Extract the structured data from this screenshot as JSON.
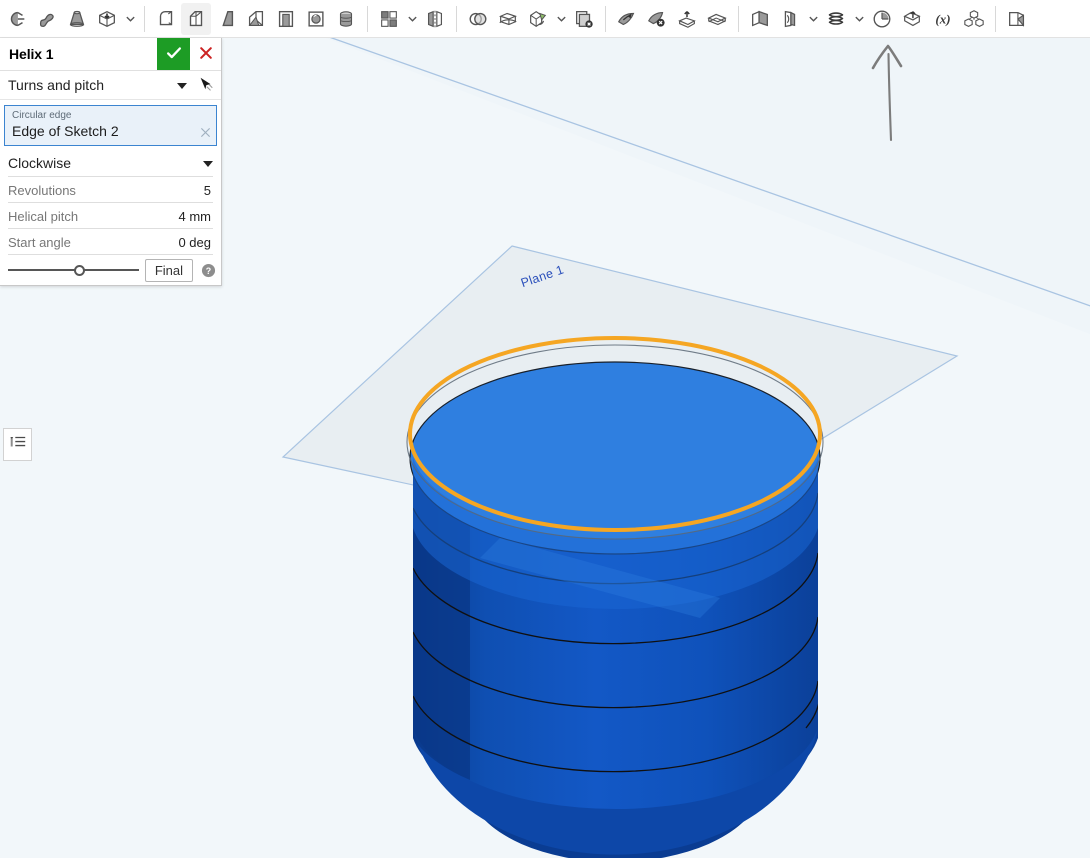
{
  "app": {
    "name": "Onshape Part Studio",
    "background_color": "#f2f7fa",
    "accent_color": "#3b84d0",
    "confirm_color": "#1d9c25",
    "cancel_color": "#cc2222",
    "selection_color": "#f5a623"
  },
  "toolbar": {
    "groups": [
      {
        "name": "sweep-loft-group",
        "items": [
          {
            "icon": "sweep-icon",
            "label": "Sweep"
          },
          {
            "icon": "loft-icon",
            "label": "Loft"
          },
          {
            "icon": "revolve-taper-icon",
            "label": "Revolve"
          },
          {
            "icon": "thicken-icon",
            "label": "Thicken"
          }
        ],
        "has_caret": true
      },
      {
        "name": "modify-group",
        "items": [
          {
            "icon": "fillet-icon",
            "label": "Fillet"
          },
          {
            "icon": "chamfer-icon",
            "label": "Chamfer",
            "active": true
          },
          {
            "icon": "draft-icon",
            "label": "Draft"
          },
          {
            "icon": "rib-icon",
            "label": "Rib"
          },
          {
            "icon": "shell-icon",
            "label": "Shell"
          },
          {
            "icon": "hole-icon",
            "label": "Hole"
          },
          {
            "icon": "thread-icon",
            "label": "Thread"
          }
        ],
        "has_caret": false
      },
      {
        "name": "pattern-group",
        "items": [
          {
            "icon": "linear-pattern-icon",
            "label": "Pattern"
          }
        ],
        "has_caret": true
      },
      {
        "name": "mirror-group",
        "items": [
          {
            "icon": "mirror-icon",
            "label": "Mirror"
          }
        ],
        "has_caret": false
      },
      {
        "name": "boolean-group",
        "items": [
          {
            "icon": "boolean-icon",
            "label": "Boolean"
          },
          {
            "icon": "split-icon",
            "label": "Split"
          },
          {
            "icon": "transform-icon",
            "label": "Transform"
          }
        ],
        "has_caret": true
      },
      {
        "name": "delete-part-group",
        "items": [
          {
            "icon": "delete-part-icon",
            "label": "Delete part"
          }
        ],
        "has_caret": false
      },
      {
        "name": "surface-group",
        "items": [
          {
            "icon": "move-face-icon",
            "label": "Move face"
          },
          {
            "icon": "delete-face-icon",
            "label": "Delete face"
          },
          {
            "icon": "replace-face-icon",
            "label": "Replace face"
          },
          {
            "icon": "offset-surface-icon",
            "label": "Offset surface"
          }
        ],
        "has_caret": false
      },
      {
        "name": "construct-group",
        "items": [
          {
            "icon": "plane-icon",
            "label": "Plane"
          },
          {
            "icon": "sketch-plane-icon",
            "label": "Derived"
          }
        ],
        "has_caret": true
      },
      {
        "name": "curve-group",
        "items": [
          {
            "icon": "helix-icon",
            "label": "Helix",
            "annotated": true
          }
        ],
        "has_caret": true
      },
      {
        "name": "misc-group",
        "items": [
          {
            "icon": "clock-icon",
            "label": "Time"
          },
          {
            "icon": "import-icon",
            "label": "Import derived"
          },
          {
            "icon": "variable-icon",
            "label": "Variable"
          },
          {
            "icon": "assembly-icon",
            "label": "Composite part"
          }
        ],
        "has_caret": false
      },
      {
        "name": "end-group",
        "items": [
          {
            "icon": "section-view-icon",
            "label": "Section view"
          }
        ],
        "has_caret": false
      }
    ]
  },
  "dialog": {
    "title": "Helix 1",
    "confirm_icon": "check-icon",
    "cancel_icon": "x-icon",
    "method": "Turns and pitch",
    "method_picker_icon": "selection-cursor-icon",
    "selection": {
      "caption": "Circular edge",
      "value": "Edge of Sketch 2",
      "clear_icon": "clear-x-icon"
    },
    "direction": "Clockwise",
    "parameters": [
      {
        "name": "Revolutions",
        "value": "5"
      },
      {
        "name": "Helical pitch",
        "value": "4 mm"
      },
      {
        "name": "Start angle",
        "value": "0 deg"
      }
    ],
    "footer": {
      "slider_position_pct": 55,
      "preview_button": "Final",
      "help_icon": "help-icon"
    }
  },
  "feature_list": {
    "icon": "feature-list-icon",
    "label": "Feature list"
  },
  "viewport": {
    "plane_label": "Plane 1",
    "annotation_arrow": "hand-drawn-up-arrow",
    "model": {
      "name": "helix-cylinder-part",
      "face_color_top": "#2f7fe0",
      "face_color_side": "#0f50bb",
      "face_color_shadow": "#0b3b8f",
      "edge_color": "#1b1b1b",
      "highlight_edge_color": "#f5a623",
      "plane_fill": "#e7edf1",
      "plane_edge": "#a9c4e2"
    }
  }
}
